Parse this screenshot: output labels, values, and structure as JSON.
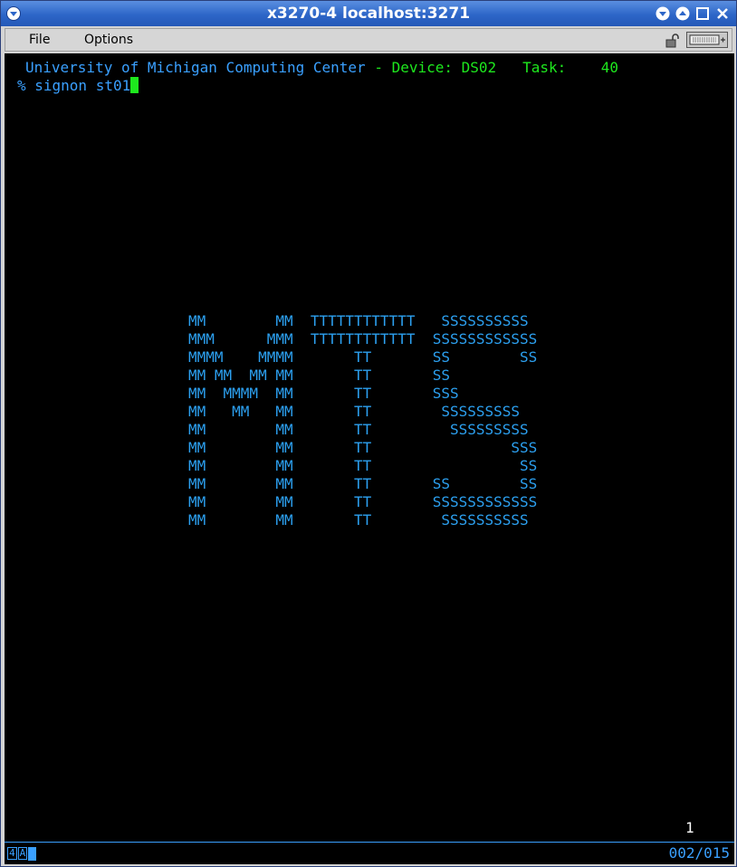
{
  "window": {
    "title": "x3270-4 localhost:3271",
    "controls": [
      "minimize-icon",
      "restore-icon",
      "maximize-icon",
      "close-icon"
    ]
  },
  "menubar": {
    "file_label": "File",
    "options_label": "Options"
  },
  "terminal": {
    "header_blue": "University of Michigan Computing Center",
    "header_sep": " - ",
    "device_label": "Device: DS02",
    "task_label": "Task:",
    "task_value": "40",
    "command_line": "% signon st01",
    "banner": [
      "MM        MM  TTTTTTTTTTTT   SSSSSSSSSS",
      "MMM      MMM  TTTTTTTTTTTT  SSSSSSSSSSSS",
      "MMMM    MMMM       TT       SS        SS",
      "MM MM  MM MM       TT       SS",
      "MM  MMMM  MM       TT       SSS",
      "MM   MM   MM       TT        SSSSSSSSS",
      "MM        MM       TT         SSSSSSSSS",
      "MM        MM       TT                SSS",
      "MM        MM       TT                 SS",
      "MM        MM       TT       SS        SS",
      "MM        MM       TT       SSSSSSSSSSSS",
      "MM        MM       TT        SSSSSSSSSS"
    ],
    "page_number": "1"
  },
  "status": {
    "indicator_4": "4",
    "indicator_A": "A",
    "cursor_position": "002/015"
  },
  "colors": {
    "title_bar": "#2d66c8",
    "terminal_blue": "#3aa0ff",
    "terminal_green": "#1ee81e"
  }
}
